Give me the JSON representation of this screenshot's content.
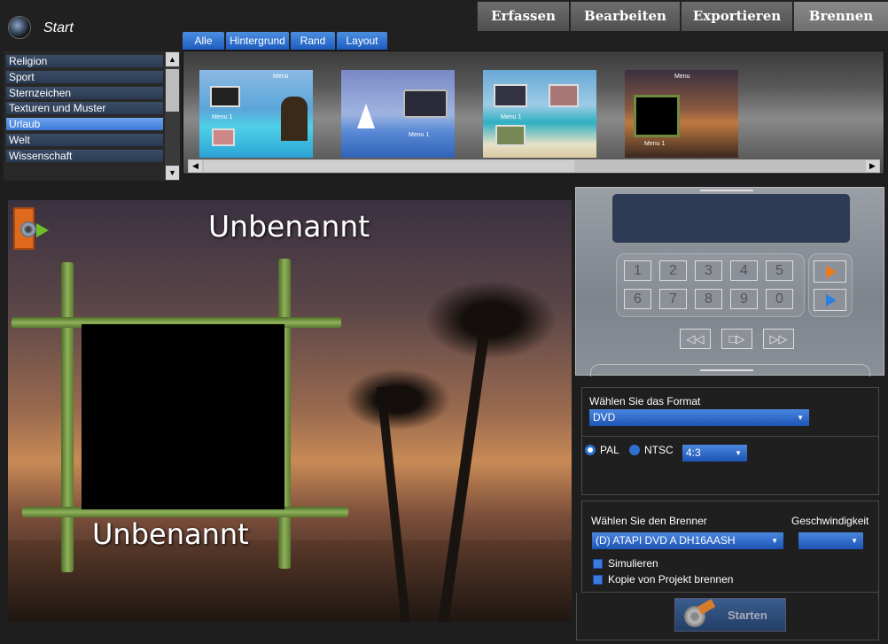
{
  "header": {
    "title": "Start"
  },
  "main_tabs": [
    {
      "label": "Erfassen"
    },
    {
      "label": "Bearbeiten"
    },
    {
      "label": "Exportieren"
    },
    {
      "label": "Brennen"
    }
  ],
  "filter_tabs": [
    {
      "label": "Alle"
    },
    {
      "label": "Hintergrund"
    },
    {
      "label": "Rand"
    },
    {
      "label": "Layout"
    }
  ],
  "categories": [
    {
      "label": "Religion"
    },
    {
      "label": "Sport"
    },
    {
      "label": "Sternzeichen"
    },
    {
      "label": "Texturen und Muster"
    },
    {
      "label": "Urlaub"
    },
    {
      "label": "Welt"
    },
    {
      "label": "Wissenschaft"
    }
  ],
  "selected_category": "Urlaub",
  "thumbnails": [
    {
      "menu_title": "Menu",
      "item": "Menu 1"
    },
    {
      "menu_title": "",
      "item": "Menu 1"
    },
    {
      "menu_title": "",
      "item": "Menu 1"
    },
    {
      "menu_title": "Menu",
      "item": "Menu 1"
    }
  ],
  "preview": {
    "title": "Unbenannt",
    "subtitle": "Unbenannt"
  },
  "remote": {
    "keys": [
      "1",
      "2",
      "3",
      "4",
      "5",
      "6",
      "7",
      "8",
      "9",
      "0"
    ],
    "transport": [
      "◁◁",
      "□▷",
      "▷▷"
    ]
  },
  "format": {
    "label": "Wählen Sie das Format",
    "value": "DVD",
    "pal_label": "PAL",
    "ntsc_label": "NTSC",
    "aspect_value": "4:3"
  },
  "burner": {
    "label": "Wählen Sie den Brenner",
    "speed_label": "Geschwindigkeit",
    "value": "(D) ATAPI DVD A  DH16AASH",
    "simulate_label": "Simulieren",
    "copy_label": "Kopie von Projekt brennen"
  },
  "start_button": {
    "label": "Starten"
  },
  "colors": {
    "accent": "#2e6fd0",
    "selected_tab": "#7a7a7a",
    "remote_screen": "#2d3b55"
  }
}
